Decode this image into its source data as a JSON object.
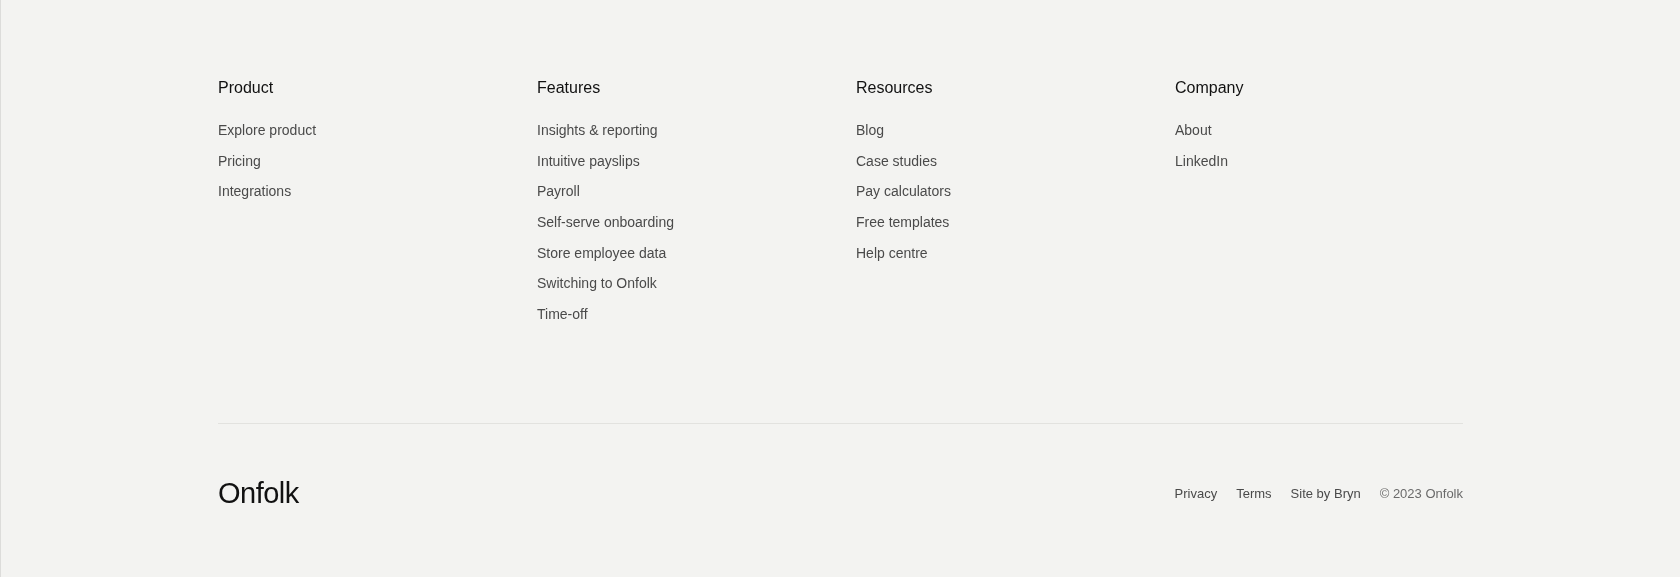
{
  "columns": [
    {
      "heading": "Product",
      "links": [
        "Explore product",
        "Pricing",
        "Integrations"
      ]
    },
    {
      "heading": "Features",
      "links": [
        "Insights & reporting",
        "Intuitive payslips",
        "Payroll",
        "Self-serve onboarding",
        "Store employee data",
        "Switching to Onfolk",
        "Time-off"
      ]
    },
    {
      "heading": "Resources",
      "links": [
        "Blog",
        "Case studies",
        "Pay calculators",
        "Free templates",
        "Help centre"
      ]
    },
    {
      "heading": "Company",
      "links": [
        "About",
        "LinkedIn"
      ]
    }
  ],
  "logo": "Onfolk",
  "legal_links": [
    "Privacy",
    "Terms",
    "Site by Bryn"
  ],
  "copyright": "© 2023 Onfolk"
}
